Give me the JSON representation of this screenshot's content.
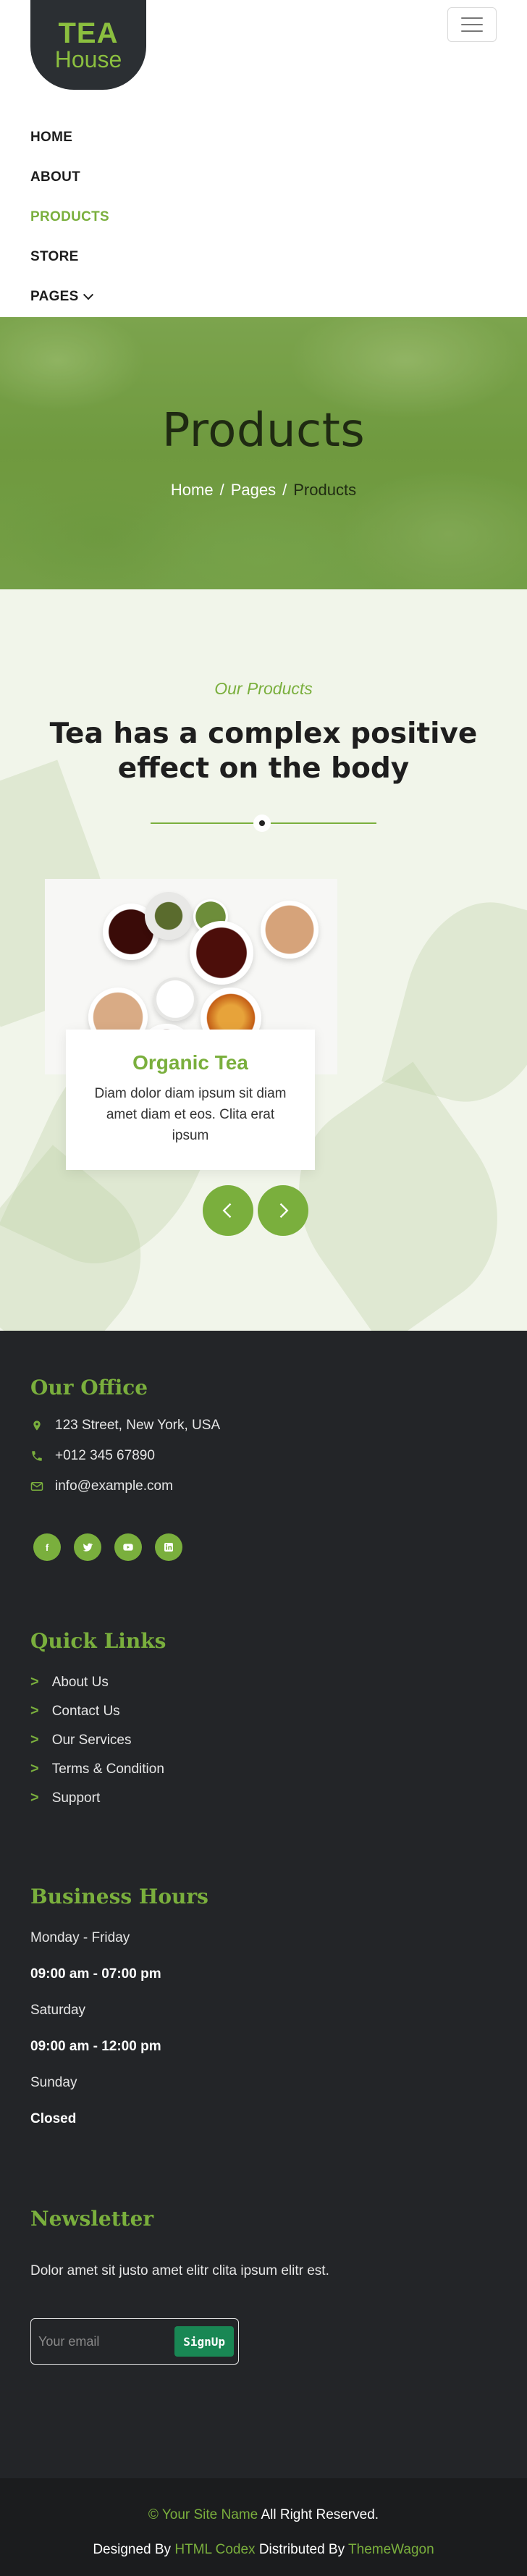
{
  "brand": {
    "logo_top": "TEA",
    "logo_bottom": "House"
  },
  "nav": {
    "items": [
      {
        "label": "HOME",
        "active": false
      },
      {
        "label": "ABOUT",
        "active": false
      },
      {
        "label": "PRODUCTS",
        "active": true
      },
      {
        "label": "STORE",
        "active": false
      },
      {
        "label": "PAGES",
        "active": false
      }
    ]
  },
  "hero": {
    "title": "Products",
    "breadcrumb": [
      "Home",
      "Pages",
      "Products"
    ]
  },
  "products": {
    "subtitle": "Our Products",
    "title": "Tea has a complex positive effect on the body",
    "card": {
      "title": "Organic Tea",
      "text": "Diam dolor diam ipsum sit diam amet diam et eos. Clita erat ipsum"
    }
  },
  "footer": {
    "office": {
      "heading": "Our Office",
      "address": "123 Street, New York, USA",
      "phone": "+012 345 67890",
      "email": "info@example.com",
      "social": [
        "facebook-icon",
        "twitter-icon",
        "youtube-icon",
        "linkedin-icon"
      ]
    },
    "quick_links": {
      "heading": "Quick Links",
      "items": [
        "About Us",
        "Contact Us",
        "Our Services",
        "Terms & Condition",
        "Support"
      ]
    },
    "hours": {
      "heading": "Business Hours",
      "rows": [
        {
          "day": "Monday - Friday",
          "time": "09:00 am - 07:00 pm"
        },
        {
          "day": "Saturday",
          "time": "09:00 am - 12:00 pm"
        },
        {
          "day": "Sunday",
          "time": "Closed"
        }
      ]
    },
    "newsletter": {
      "heading": "Newsletter",
      "text": "Dolor amet sit justo amet elitr clita ipsum elitr est.",
      "placeholder": "Your email",
      "button": "SignUp"
    }
  },
  "copyright": {
    "site_name": "© Your Site Name",
    "rights": " All Right Reserved.",
    "designed_by": "Designed By ",
    "html_codex": "HTML Codex",
    "distributed_by": " Distributed By ",
    "themewagon": "ThemeWagon"
  },
  "colors": {
    "accent": "#7aaf3d",
    "dark": "#232528",
    "signup": "#198754"
  }
}
